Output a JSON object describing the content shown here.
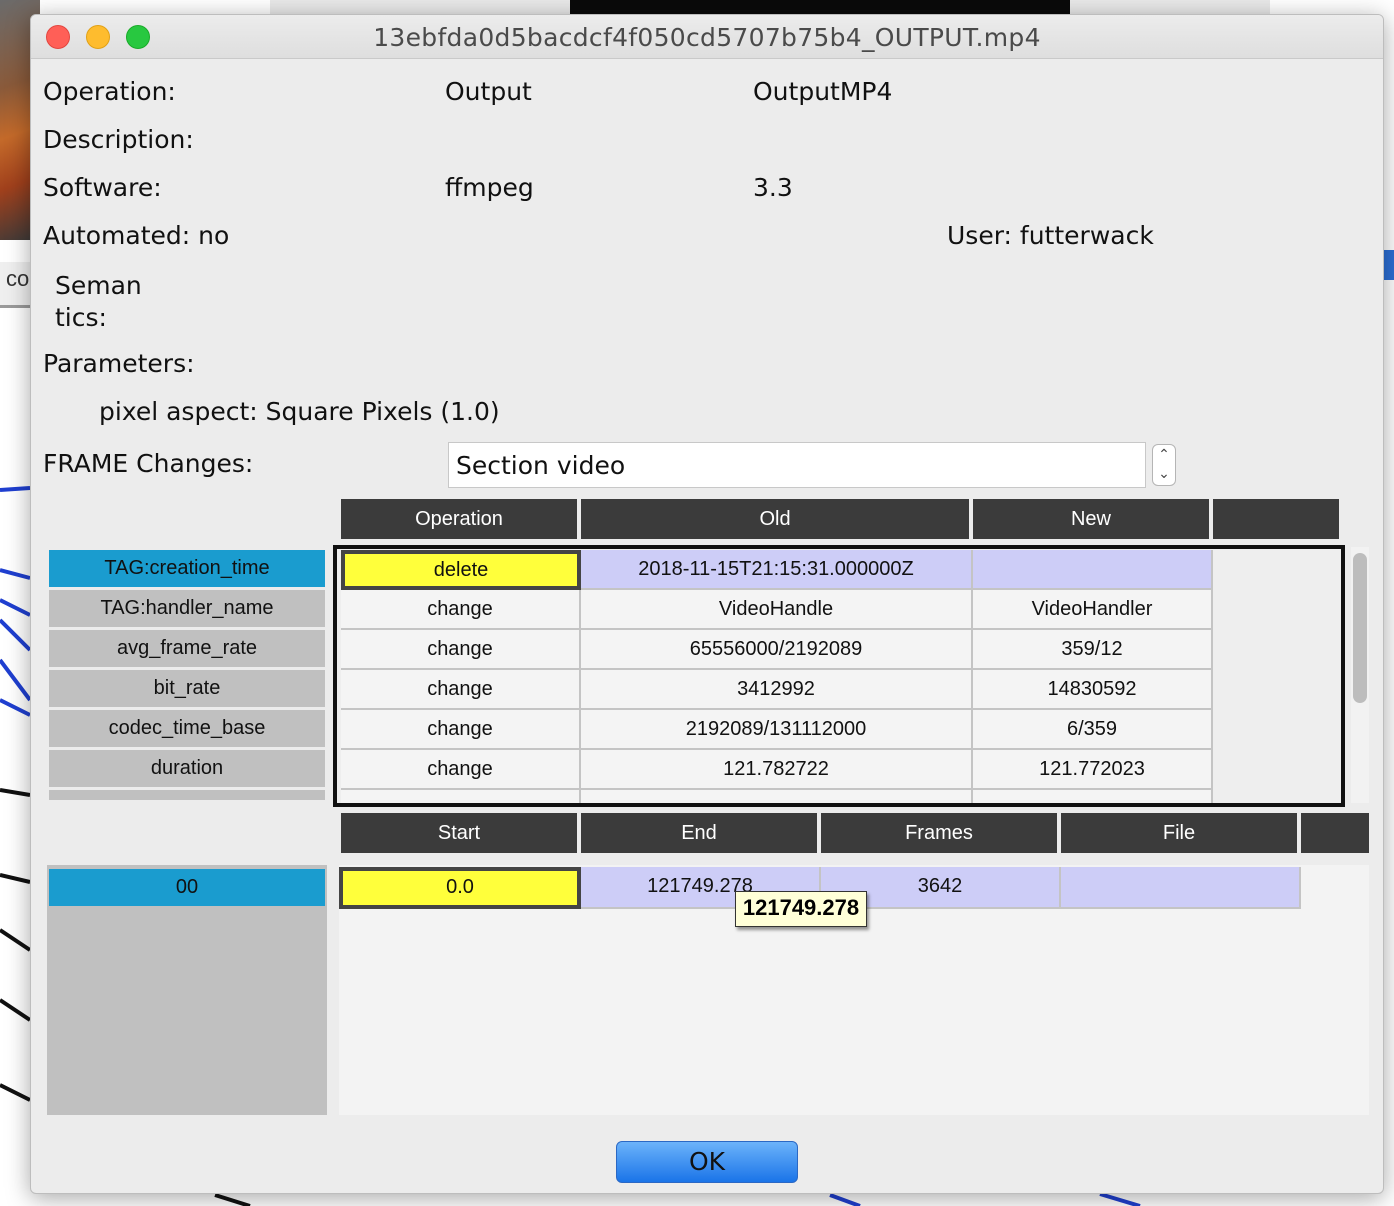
{
  "window": {
    "title": "13ebfda0d5bacdcf4f050cd5707b75b4_OUTPUT.mp4"
  },
  "background": {
    "tab_fragment": "co"
  },
  "info": {
    "operation_label": "Operation:",
    "operation_value": "Output",
    "operation_detail": "OutputMP4",
    "description_label": "Description:",
    "software_label": "Software:",
    "software_name": "ffmpeg",
    "software_version": "3.3",
    "automated": "Automated: no",
    "user": "User: futterwack",
    "semantics_line1": "Seman",
    "semantics_line2": "tics:",
    "parameters_label": "Parameters:",
    "parameter_1": "pixel aspect: Square Pixels (1.0)",
    "frame_changes_label": "FRAME Changes:",
    "frame_changes_selected": "Section video"
  },
  "changes_table": {
    "columns": [
      "Operation",
      "Old",
      "New",
      ""
    ],
    "rows": [
      {
        "key": "TAG:creation_time",
        "operation": "delete",
        "old": "2018-11-15T21:15:31.000000Z",
        "new": ""
      },
      {
        "key": "TAG:handler_name",
        "operation": "change",
        "old": "VideoHandle",
        "new": "VideoHandler"
      },
      {
        "key": "avg_frame_rate",
        "operation": "change",
        "old": "65556000/2192089",
        "new": "359/12"
      },
      {
        "key": "bit_rate",
        "operation": "change",
        "old": "3412992",
        "new": "14830592"
      },
      {
        "key": "codec_time_base",
        "operation": "change",
        "old": "2192089/131112000",
        "new": "6/359"
      },
      {
        "key": "duration",
        "operation": "change",
        "old": "121.782722",
        "new": "121.772023"
      }
    ]
  },
  "sections_table": {
    "columns": [
      "Start",
      "End",
      "Frames",
      "File",
      ""
    ],
    "rows": [
      {
        "key": "00",
        "start": "0.0",
        "end": "121749.278",
        "frames": "3642",
        "file": ""
      }
    ]
  },
  "tooltip": "121749.278",
  "buttons": {
    "ok": "OK"
  }
}
